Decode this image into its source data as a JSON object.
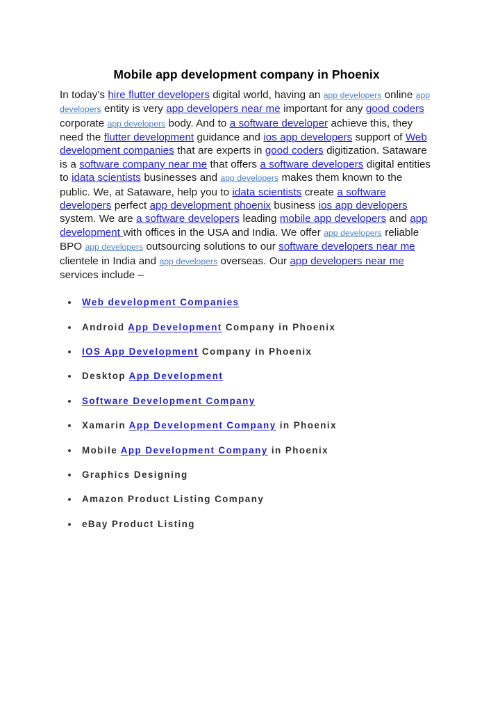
{
  "document": {
    "title": "Mobile app development company in Phoenix",
    "paragraph": {
      "segments": [
        {
          "type": "text",
          "text": "In today’s "
        },
        {
          "type": "link",
          "text": "hire flutter developers"
        },
        {
          "type": "text",
          "text": " digital world, having an "
        },
        {
          "type": "link-small",
          "text": "app developers"
        },
        {
          "type": "text",
          "text": " online "
        },
        {
          "type": "link-small",
          "text": "app developers"
        },
        {
          "type": "text",
          "text": " entity is very "
        },
        {
          "type": "link",
          "text": "app developers near me"
        },
        {
          "type": "text",
          "text": " important for any "
        },
        {
          "type": "link",
          "text": "good coders"
        },
        {
          "type": "text",
          "text": " corporate "
        },
        {
          "type": "link-small",
          "text": "app developers"
        },
        {
          "type": "text",
          "text": " body. And to "
        },
        {
          "type": "link",
          "text": "a software developer"
        },
        {
          "type": "text",
          "text": " achieve this, they need the "
        },
        {
          "type": "link",
          "text": "flutter development"
        },
        {
          "type": "text",
          "text": " guidance and "
        },
        {
          "type": "link",
          "text": "ios app developers"
        },
        {
          "type": "text",
          "text": " support of "
        },
        {
          "type": "link",
          "text": "Web development companies"
        },
        {
          "type": "text",
          "text": " that are experts in "
        },
        {
          "type": "link",
          "text": "good coders"
        },
        {
          "type": "text",
          "text": " digitization. Sataware is a "
        },
        {
          "type": "link",
          "text": "software company near me"
        },
        {
          "type": "text",
          "text": " that offers "
        },
        {
          "type": "link",
          "text": "a software developers"
        },
        {
          "type": "text",
          "text": " digital entities to "
        },
        {
          "type": "link",
          "text": "idata scientists"
        },
        {
          "type": "text",
          "text": " businesses and "
        },
        {
          "type": "link-small",
          "text": "app developers"
        },
        {
          "type": "text",
          "text": " makes them known to the public. We, at Sataware, help you to "
        },
        {
          "type": "link",
          "text": "idata scientists"
        },
        {
          "type": "text",
          "text": " create "
        },
        {
          "type": "link",
          "text": "a software developers"
        },
        {
          "type": "text",
          "text": " perfect "
        },
        {
          "type": "link",
          "text": "app development phoenix"
        },
        {
          "type": "text",
          "text": " business "
        },
        {
          "type": "link",
          "text": "ios app developers"
        },
        {
          "type": "text",
          "text": " system. We are "
        },
        {
          "type": "link",
          "text": "a software developers"
        },
        {
          "type": "text",
          "text": " leading "
        },
        {
          "type": "link",
          "text": "mobile app developers"
        },
        {
          "type": "text",
          "text": " and "
        },
        {
          "type": "link",
          "text": "app development "
        },
        {
          "type": "text",
          "text": "with offices in the USA and India. We offer "
        },
        {
          "type": "link-small",
          "text": "app developers"
        },
        {
          "type": "text",
          "text": " reliable BPO "
        },
        {
          "type": "link-small",
          "text": "app developers"
        },
        {
          "type": "text",
          "text": " outsourcing solutions to our "
        },
        {
          "type": "link",
          "text": "software developers near me"
        },
        {
          "type": "text",
          "text": " clientele in India and "
        },
        {
          "type": "link-small",
          "text": "app developers"
        },
        {
          "type": "text",
          "text": " overseas. Our "
        },
        {
          "type": "link",
          "text": "app developers near me"
        },
        {
          "type": "text",
          "text": " services include –"
        }
      ]
    },
    "services_list": [
      {
        "parts": [
          {
            "type": "link",
            "text": "Web development Companies"
          }
        ]
      },
      {
        "parts": [
          {
            "type": "text",
            "text": "Android "
          },
          {
            "type": "link",
            "text": "App Development"
          },
          {
            "type": "text",
            "text": " Company in Phoenix"
          }
        ]
      },
      {
        "parts": [
          {
            "type": "link",
            "text": "IOS App Development"
          },
          {
            "type": "text",
            "text": " Company in Phoenix"
          }
        ]
      },
      {
        "parts": [
          {
            "type": "text",
            "text": "Desktop "
          },
          {
            "type": "link",
            "text": "App Development"
          }
        ]
      },
      {
        "parts": [
          {
            "type": "link",
            "text": "Software Development Company"
          }
        ]
      },
      {
        "parts": [
          {
            "type": "text",
            "text": "Xamarin "
          },
          {
            "type": "link",
            "text": "App Development Company"
          },
          {
            "type": "text",
            "text": " in Phoenix"
          }
        ]
      },
      {
        "parts": [
          {
            "type": "text",
            "text": "Mobile "
          },
          {
            "type": "link",
            "text": "App Development Company"
          },
          {
            "type": "text",
            "text": " in Phoenix"
          }
        ]
      },
      {
        "parts": [
          {
            "type": "text",
            "text": "Graphics Designing"
          }
        ]
      },
      {
        "parts": [
          {
            "type": "text",
            "text": "Amazon Product Listing Company"
          }
        ]
      },
      {
        "parts": [
          {
            "type": "text",
            "text": "eBay Product Listing"
          }
        ]
      }
    ],
    "colors": {
      "link_primary": "#1f1fd4",
      "link_secondary": "#4a84c4",
      "body_text": "#1a1a1a",
      "bullet_text": "#303030",
      "page_background": "#ffffff"
    }
  }
}
